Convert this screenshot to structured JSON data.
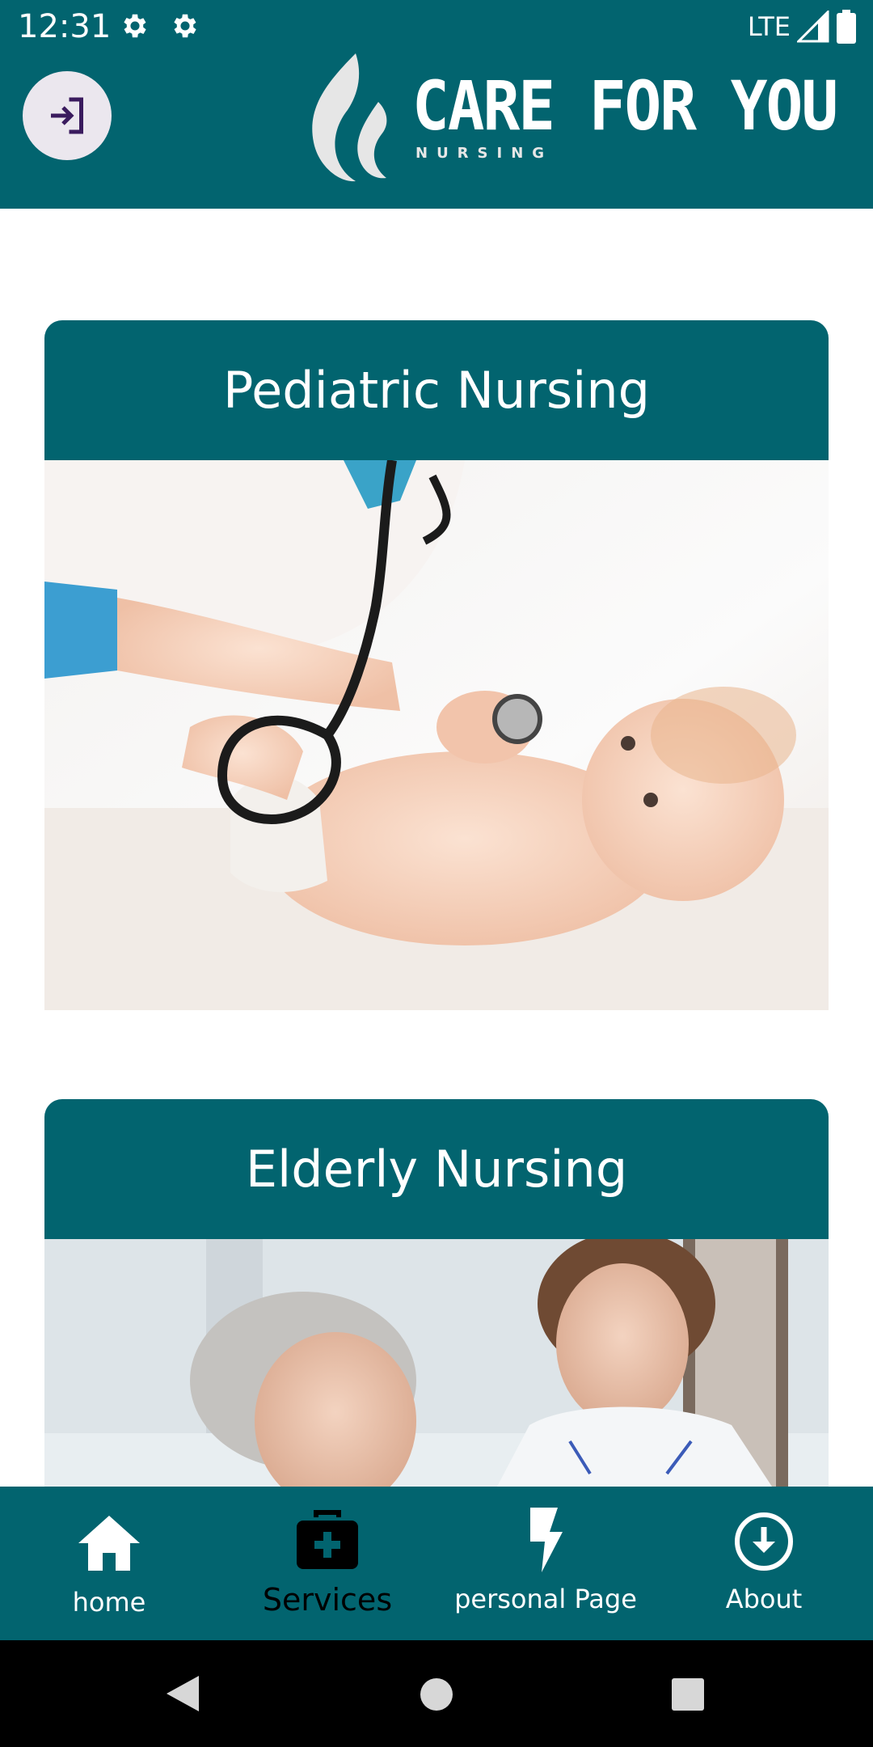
{
  "status_bar": {
    "time": "12:31",
    "network": "LTE"
  },
  "header": {
    "logo_title": "CARE FOR YOU",
    "logo_subtitle": "NURSING"
  },
  "services": [
    {
      "title": "Pediatric Nursing"
    },
    {
      "title": "Elderly Nursing"
    }
  ],
  "bottom_nav": {
    "items": [
      {
        "label": "home",
        "icon": "home-icon"
      },
      {
        "label": "Services",
        "icon": "medical-kit-icon",
        "selected": true
      },
      {
        "label": "personal Page",
        "icon": "flash-icon"
      },
      {
        "label": "About",
        "icon": "download-circle-icon"
      }
    ]
  },
  "colors": {
    "primary": "#02646f",
    "selected_nav": "#000000",
    "nav_text": "#ffffff"
  }
}
